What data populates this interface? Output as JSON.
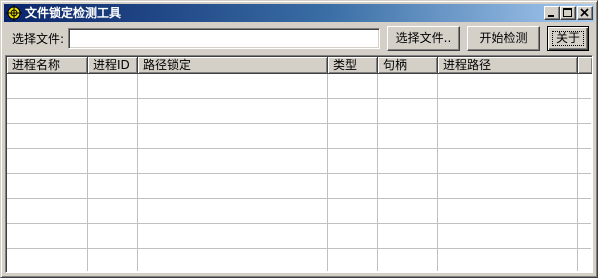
{
  "window": {
    "title": "文件锁定检测工具",
    "icon": "crosshair-icon",
    "controls": [
      "minimize-icon",
      "maximize-icon",
      "close-icon"
    ]
  },
  "toolbar": {
    "file_label": "选择文件:",
    "file_value": "",
    "browse_label": "选择文件..",
    "start_label": "开始检测",
    "about_label": "关于"
  },
  "table": {
    "columns": [
      "进程名称",
      "进程ID",
      "路径锁定",
      "类型",
      "句柄",
      "进程路径"
    ],
    "rows": []
  },
  "colors": {
    "titlebar_start": "#0a246a",
    "titlebar_end": "#a6caf0",
    "face": "#d4d0c8"
  }
}
